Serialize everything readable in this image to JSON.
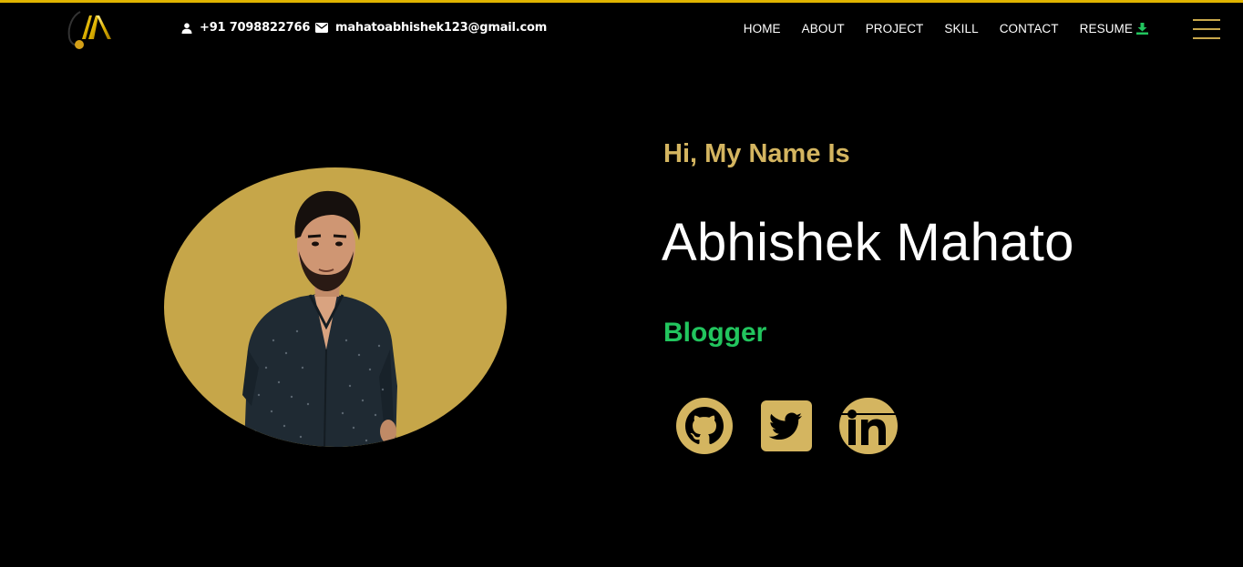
{
  "header": {
    "logo_icon": "am-logo-icon",
    "phone": "+91 7098822766",
    "email": "mahatoabhishek123@gmail.com",
    "phone_icon": "person-icon",
    "email_icon": "envelope-icon",
    "nav": [
      {
        "label": "HOME"
      },
      {
        "label": "ABOUT"
      },
      {
        "label": "PROJECT"
      },
      {
        "label": "SKILL"
      },
      {
        "label": "CONTACT"
      },
      {
        "label": "RESUME",
        "icon": "download-icon"
      }
    ],
    "menu_icon": "hamburger-menu-icon"
  },
  "hero": {
    "greeting": "Hi, My Name Is",
    "name": "Abhishek Mahato",
    "role": "Blogger",
    "social": [
      {
        "icon": "github-icon"
      },
      {
        "icon": "twitter-icon"
      },
      {
        "icon": "linkedin-icon"
      }
    ]
  },
  "colors": {
    "background": "#000000",
    "accent_gold": "#c9a84c",
    "accent_green": "#22c55e",
    "top_border": "#e0b400",
    "text": "#ffffff"
  }
}
